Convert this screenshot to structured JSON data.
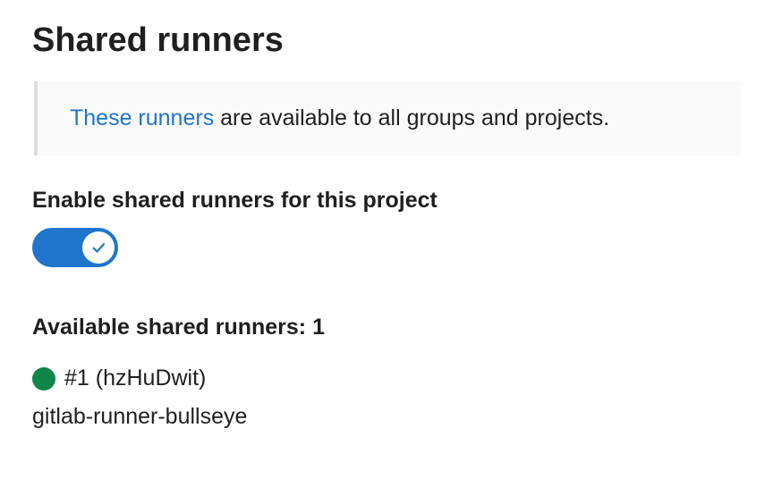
{
  "header": {
    "title": "Shared runners"
  },
  "info_box": {
    "link_text": "These runners",
    "rest_text": " are available to all groups and projects."
  },
  "setting": {
    "label": "Enable shared runners for this project",
    "enabled": true
  },
  "available": {
    "label_prefix": "Available shared runners: ",
    "count": "1"
  },
  "runners": [
    {
      "id_text": "#1 (hzHuDwit)",
      "name": "gitlab-runner-bullseye",
      "status_color": "#108548"
    }
  ]
}
